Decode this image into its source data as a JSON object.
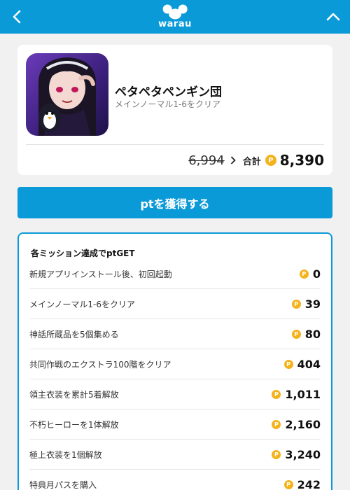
{
  "header": {
    "logo_text": "warau",
    "back_icon": "chevron-left-icon",
    "collapse_icon": "chevron-up-icon",
    "color": "#0a9ad8"
  },
  "app": {
    "name": "ペタペタペンギン団",
    "condition": "メインノーマル1-6をクリア",
    "old_points": "6,994",
    "total_label": "合計",
    "total_points": "8,390"
  },
  "cta": {
    "label": "ptを獲得する"
  },
  "missions": {
    "title": "各ミッション達成でptGET",
    "items": [
      {
        "label": "新規アプリインストール後、初回起動",
        "points": "0"
      },
      {
        "label": "メインノーマル1-6をクリア",
        "points": "39"
      },
      {
        "label": "神話所蔵品を5個集める",
        "points": "80"
      },
      {
        "label": "共同作戦のエクストラ100階をクリア",
        "points": "404"
      },
      {
        "label": "領主衣装を累計5着解放",
        "points": "1,011"
      },
      {
        "label": "不朽ヒーローを1体解放",
        "points": "2,160"
      },
      {
        "label": "極上衣装を1個解放",
        "points": "3,240"
      },
      {
        "label": "特典月パスを購入",
        "points": "242"
      }
    ]
  },
  "coin_symbol": "P",
  "colors": {
    "accent": "#0a9ad8",
    "coin": "#f4b21b"
  }
}
